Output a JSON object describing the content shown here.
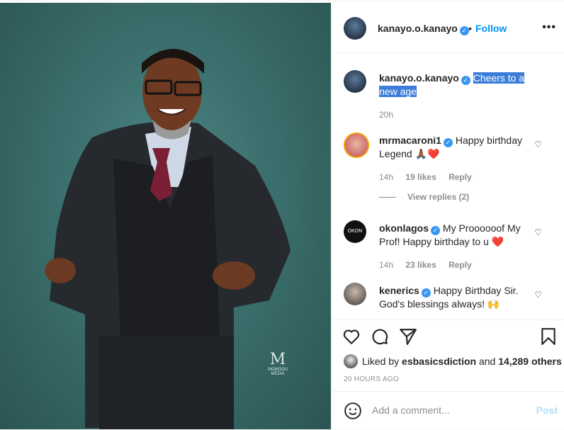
{
  "post": {
    "username": "kanayo.o.kanayo",
    "verified_icon": "verified-badge-icon",
    "separator": "•",
    "follow_label": "Follow",
    "more_icon": "•••",
    "watermark_text": "MOMODU MEDIA"
  },
  "caption": {
    "username": "kanayo.o.kanayo",
    "text": "Cheers to a new age",
    "time": "20h"
  },
  "comments": [
    {
      "username": "mrmacaroni1",
      "text": "Happy birthday Legend 🙏🏾❤️",
      "time": "14h",
      "likes": "19 likes",
      "reply": "Reply"
    },
    {
      "username": "okonlagos",
      "text": "My Proooooof My Prof! Happy birthday to u ❤️",
      "time": "14h",
      "likes": "23 likes",
      "reply": "Reply"
    },
    {
      "username": "kenerics",
      "text": "Happy Birthday Sir. God's blessings always! 🙌"
    }
  ],
  "view_replies": "View replies (2)",
  "likes": {
    "prefix": "Liked by",
    "user": "esbasicsdiction",
    "middle": "and",
    "count": "14,289 others"
  },
  "timestamp": "20 HOURS AGO",
  "add_comment": {
    "placeholder": "Add a comment...",
    "post_label": "Post"
  },
  "colors": {
    "accent": "#0095f6",
    "backdrop": "#3b6f6d",
    "heart": "#ed4956"
  }
}
